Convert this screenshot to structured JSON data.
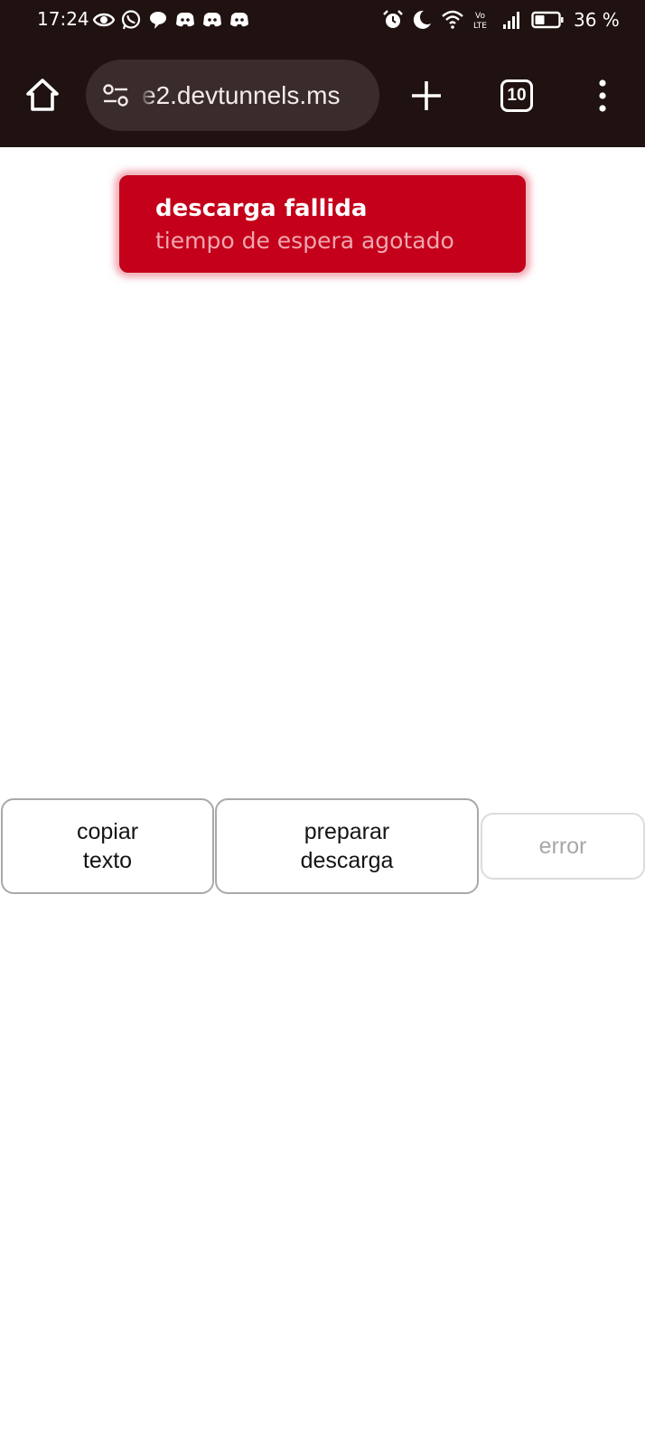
{
  "status_bar": {
    "time": "17:24",
    "battery_percent": "36 %",
    "left_icons": [
      "eye-icon",
      "whatsapp-icon",
      "chat-bubble-icon",
      "discord-icon",
      "discord-icon",
      "discord-icon"
    ],
    "right_icons": [
      "alarm-icon",
      "moon-icon",
      "wifi-icon",
      "volte-icon",
      "signal-icon",
      "battery-icon"
    ],
    "volte_top": "Vo",
    "volte_bottom": "LTE"
  },
  "browser": {
    "url_text": "e2.devtunnels.ms",
    "tab_count": "10"
  },
  "toast": {
    "title": "descarga fallida",
    "subtitle": "tiempo de espera agotado",
    "color": "#c4001a"
  },
  "buttons": {
    "copy": {
      "line1": "copiar",
      "line2": "texto"
    },
    "prepare": {
      "line1": "preparar",
      "line2": "descarga"
    },
    "error": {
      "label": "error"
    }
  }
}
